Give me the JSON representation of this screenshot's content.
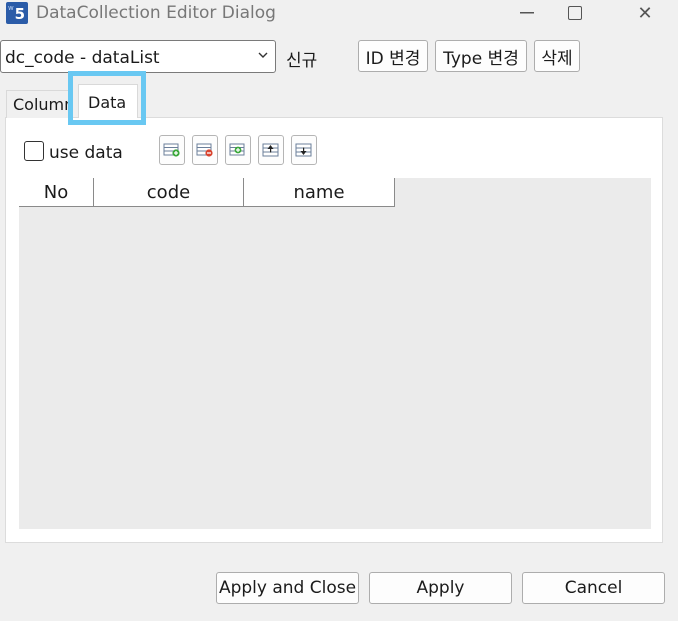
{
  "window": {
    "title": "DataCollection Editor Dialog",
    "app_icon_text": "5",
    "app_icon_sub": "w",
    "close_glyph": "✕"
  },
  "toolbar": {
    "collection_value": "dc_code - dataList",
    "new_label": "신규",
    "id_change_label": "ID 변경",
    "type_change_label": "Type 변경",
    "delete_label": "삭제"
  },
  "tabs": [
    {
      "label": "Column",
      "selected": false
    },
    {
      "label": "Data",
      "selected": true
    }
  ],
  "data_tab": {
    "use_data_label": "use data",
    "use_data_checked": false,
    "tool_icons": [
      "add-row-icon",
      "delete-row-icon",
      "insert-row-icon",
      "move-up-icon",
      "move-down-icon"
    ],
    "columns": [
      "No",
      "code",
      "name"
    ]
  },
  "footer": {
    "apply_close_label": "Apply and Close",
    "apply_label": "Apply",
    "cancel_label": "Cancel"
  },
  "colors": {
    "highlight": "#69c8f2",
    "app_icon": "#2b5ca8"
  }
}
